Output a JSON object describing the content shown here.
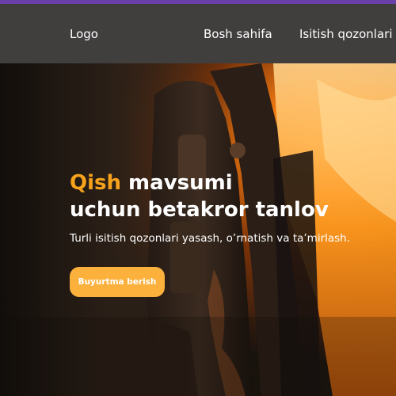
{
  "nav": {
    "logo": "Logo",
    "items": [
      {
        "label": "Bosh sahifa"
      },
      {
        "label": "Isitish qozonlari"
      }
    ]
  },
  "hero": {
    "title_accent": "Qish",
    "title_line1_rest": " mavsumi",
    "title_line2": "uchun betakror tanlov",
    "subtitle": "Turli isitish qozonlari yasash, o’rnatish va ta’mirlash.",
    "cta_label": "Buyurtma berish"
  },
  "colors": {
    "top_strip": "#6b3fa8",
    "navbar_bg": "#413e3e",
    "accent": "#f7a21b",
    "button_bg": "#fbb13c"
  }
}
